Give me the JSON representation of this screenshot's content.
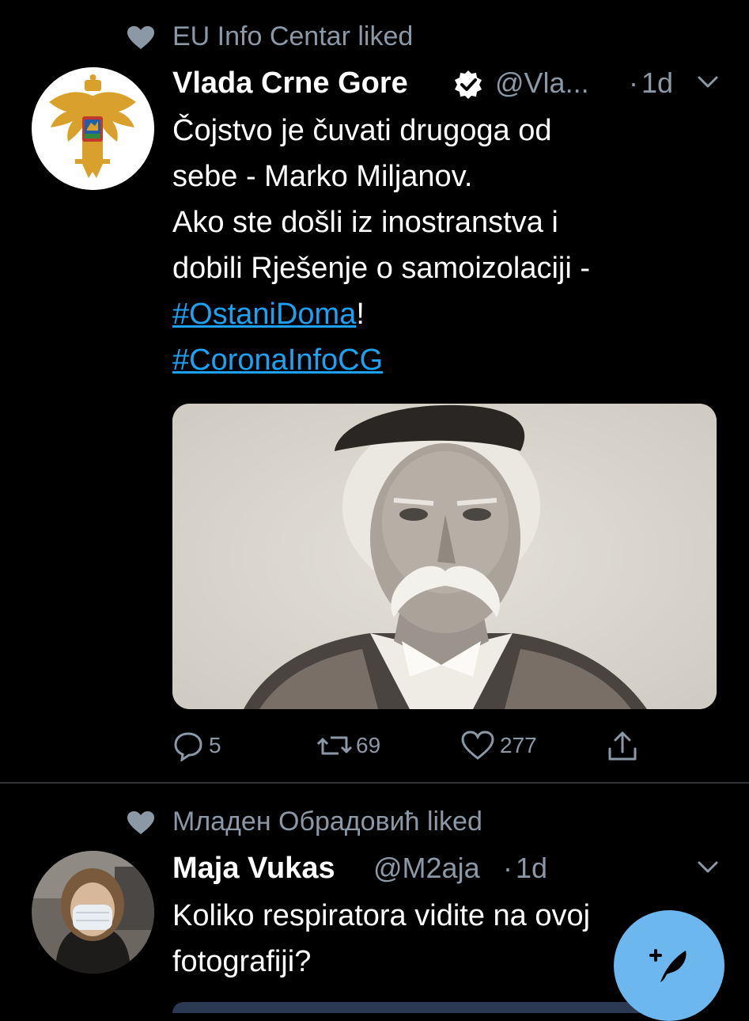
{
  "tweet1": {
    "context": "EU Info Centar liked",
    "name": "Vlada Crne Gore",
    "handle": "@Vla...",
    "time": "1d",
    "body_line1": "Čojstvo je čuvati drugoga od",
    "body_line2": "sebe - Marko Miljanov.",
    "body_line3": "Ako ste došli iz inostranstva i",
    "body_line4": "dobili Rješenje o samoizolaciji -",
    "hashtag1": "#OstaniDoma",
    "hashtag1_suffix": "!",
    "hashtag2": "#CoronaInfoCG",
    "replies": "5",
    "retweets": "69",
    "likes": "277"
  },
  "tweet2": {
    "context": "Младен Обрадовић liked",
    "name": "Maja Vukas",
    "handle": "@M2aja",
    "time": "1d",
    "body_line1": "Koliko respiratora vidite na ovoj",
    "body_line2": "fotografiji?"
  },
  "colors": {
    "background": "#000000",
    "secondary_text": "#8b98a5",
    "link": "#1da1f2",
    "fab": "#6cb7ee"
  },
  "icons": [
    "heart-icon",
    "verified-badge-icon",
    "chevron-down-icon",
    "reply-icon",
    "retweet-icon",
    "like-icon",
    "share-icon",
    "compose-icon"
  ]
}
